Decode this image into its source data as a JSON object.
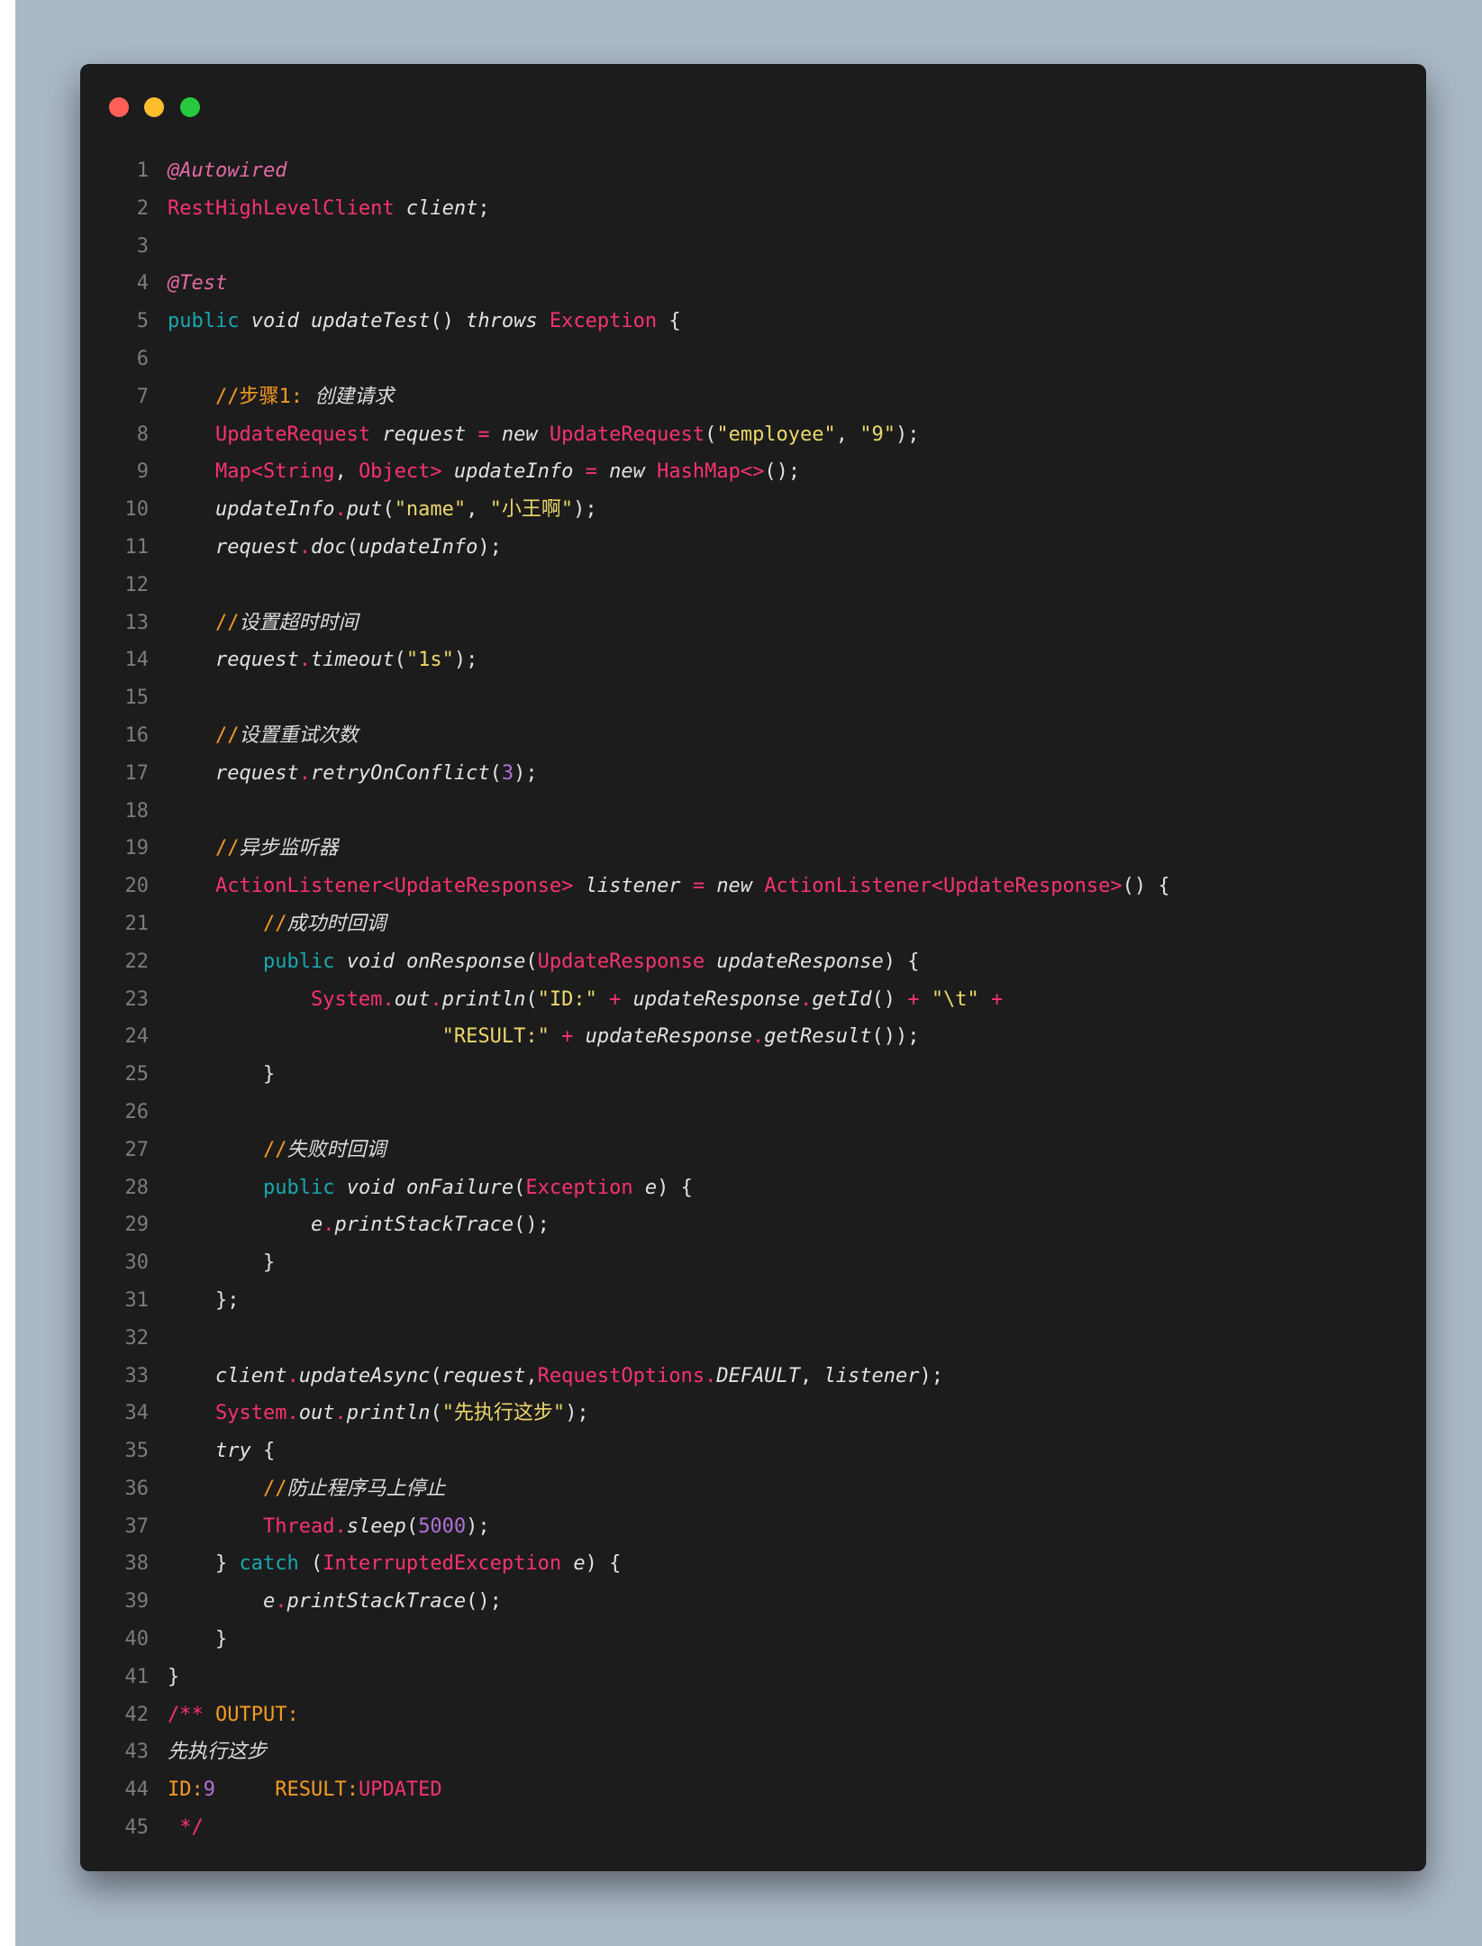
{
  "window": {
    "controls": [
      {
        "name": "close",
        "color": "#ff5f56"
      },
      {
        "name": "minimize",
        "color": "#ffbd2e"
      },
      {
        "name": "maximize",
        "color": "#27c93f"
      }
    ]
  },
  "lines": [
    [
      [
        "a",
        "@Autowired"
      ]
    ],
    [
      [
        "t",
        "RestHighLevelClient"
      ],
      [
        "p",
        " "
      ],
      [
        "i",
        "client"
      ],
      [
        "p",
        ";"
      ]
    ],
    [],
    [
      [
        "a",
        "@Test"
      ]
    ],
    [
      [
        "k",
        "public"
      ],
      [
        "p",
        " "
      ],
      [
        "i",
        "void"
      ],
      [
        "p",
        " "
      ],
      [
        "i",
        "updateTest"
      ],
      [
        "p",
        "() "
      ],
      [
        "i",
        "throws"
      ],
      [
        "p",
        " "
      ],
      [
        "t",
        "Exception"
      ],
      [
        "p",
        " {"
      ]
    ],
    [],
    [
      [
        "p",
        "    "
      ],
      [
        "c",
        "//步骤1: "
      ],
      [
        "ci",
        "创建请求"
      ]
    ],
    [
      [
        "p",
        "    "
      ],
      [
        "t",
        "UpdateRequest"
      ],
      [
        "p",
        " "
      ],
      [
        "i",
        "request"
      ],
      [
        "p",
        " "
      ],
      [
        "o",
        "="
      ],
      [
        "p",
        " "
      ],
      [
        "i",
        "new"
      ],
      [
        "p",
        " "
      ],
      [
        "t",
        "UpdateRequest"
      ],
      [
        "p",
        "("
      ],
      [
        "s",
        "\"employee\""
      ],
      [
        "p",
        ", "
      ],
      [
        "s",
        "\"9\""
      ],
      [
        "p",
        ");"
      ]
    ],
    [
      [
        "p",
        "    "
      ],
      [
        "t",
        "Map<String"
      ],
      [
        "p",
        ", "
      ],
      [
        "t",
        "Object>"
      ],
      [
        "p",
        " "
      ],
      [
        "i",
        "updateInfo"
      ],
      [
        "p",
        " "
      ],
      [
        "o",
        "="
      ],
      [
        "p",
        " "
      ],
      [
        "i",
        "new"
      ],
      [
        "p",
        " "
      ],
      [
        "t",
        "HashMap<>"
      ],
      [
        "p",
        "();"
      ]
    ],
    [
      [
        "p",
        "    "
      ],
      [
        "i",
        "updateInfo"
      ],
      [
        "o",
        "."
      ],
      [
        "i",
        "put"
      ],
      [
        "p",
        "("
      ],
      [
        "s",
        "\"name\""
      ],
      [
        "p",
        ", "
      ],
      [
        "s",
        "\"小王啊\""
      ],
      [
        "p",
        ");"
      ]
    ],
    [
      [
        "p",
        "    "
      ],
      [
        "i",
        "request"
      ],
      [
        "o",
        "."
      ],
      [
        "i",
        "doc"
      ],
      [
        "p",
        "("
      ],
      [
        "i",
        "updateInfo"
      ],
      [
        "p",
        ");"
      ]
    ],
    [],
    [
      [
        "p",
        "    "
      ],
      [
        "c",
        "//"
      ],
      [
        "ci",
        "设置超时时间"
      ]
    ],
    [
      [
        "p",
        "    "
      ],
      [
        "i",
        "request"
      ],
      [
        "o",
        "."
      ],
      [
        "i",
        "timeout"
      ],
      [
        "p",
        "("
      ],
      [
        "s",
        "\"1s\""
      ],
      [
        "p",
        ");"
      ]
    ],
    [],
    [
      [
        "p",
        "    "
      ],
      [
        "c",
        "//"
      ],
      [
        "ci",
        "设置重试次数"
      ]
    ],
    [
      [
        "p",
        "    "
      ],
      [
        "i",
        "request"
      ],
      [
        "o",
        "."
      ],
      [
        "i",
        "retryOnConflict"
      ],
      [
        "p",
        "("
      ],
      [
        "n",
        "3"
      ],
      [
        "p",
        ");"
      ]
    ],
    [],
    [
      [
        "p",
        "    "
      ],
      [
        "c",
        "//"
      ],
      [
        "ci",
        "异步监听器"
      ]
    ],
    [
      [
        "p",
        "    "
      ],
      [
        "t",
        "ActionListener<UpdateResponse>"
      ],
      [
        "p",
        " "
      ],
      [
        "i",
        "listener"
      ],
      [
        "p",
        " "
      ],
      [
        "o",
        "="
      ],
      [
        "p",
        " "
      ],
      [
        "i",
        "new"
      ],
      [
        "p",
        " "
      ],
      [
        "t",
        "ActionListener<UpdateResponse>"
      ],
      [
        "p",
        "() {"
      ]
    ],
    [
      [
        "p",
        "        "
      ],
      [
        "c",
        "//"
      ],
      [
        "ci",
        "成功时回调"
      ]
    ],
    [
      [
        "p",
        "        "
      ],
      [
        "k",
        "public"
      ],
      [
        "p",
        " "
      ],
      [
        "i",
        "void"
      ],
      [
        "p",
        " "
      ],
      [
        "i",
        "onResponse"
      ],
      [
        "p",
        "("
      ],
      [
        "t",
        "UpdateResponse"
      ],
      [
        "p",
        " "
      ],
      [
        "i",
        "updateResponse"
      ],
      [
        "p",
        ") {"
      ]
    ],
    [
      [
        "p",
        "            "
      ],
      [
        "t",
        "System"
      ],
      [
        "o",
        "."
      ],
      [
        "i",
        "out"
      ],
      [
        "o",
        "."
      ],
      [
        "i",
        "println"
      ],
      [
        "p",
        "("
      ],
      [
        "s",
        "\"ID:\""
      ],
      [
        "p",
        " "
      ],
      [
        "o",
        "+"
      ],
      [
        "p",
        " "
      ],
      [
        "i",
        "updateResponse"
      ],
      [
        "o",
        "."
      ],
      [
        "i",
        "getId"
      ],
      [
        "p",
        "() "
      ],
      [
        "o",
        "+"
      ],
      [
        "p",
        " "
      ],
      [
        "s",
        "\"\\t\""
      ],
      [
        "p",
        " "
      ],
      [
        "o",
        "+"
      ]
    ],
    [
      [
        "p",
        "                       "
      ],
      [
        "s",
        "\"RESULT:\""
      ],
      [
        "p",
        " "
      ],
      [
        "o",
        "+"
      ],
      [
        "p",
        " "
      ],
      [
        "i",
        "updateResponse"
      ],
      [
        "o",
        "."
      ],
      [
        "i",
        "getResult"
      ],
      [
        "p",
        "());"
      ]
    ],
    [
      [
        "p",
        "        }"
      ]
    ],
    [],
    [
      [
        "p",
        "        "
      ],
      [
        "c",
        "//"
      ],
      [
        "ci",
        "失败时回调"
      ]
    ],
    [
      [
        "p",
        "        "
      ],
      [
        "k",
        "public"
      ],
      [
        "p",
        " "
      ],
      [
        "i",
        "void"
      ],
      [
        "p",
        " "
      ],
      [
        "i",
        "onFailure"
      ],
      [
        "p",
        "("
      ],
      [
        "t",
        "Exception"
      ],
      [
        "p",
        " "
      ],
      [
        "i",
        "e"
      ],
      [
        "p",
        ") {"
      ]
    ],
    [
      [
        "p",
        "            "
      ],
      [
        "i",
        "e"
      ],
      [
        "o",
        "."
      ],
      [
        "i",
        "printStackTrace"
      ],
      [
        "p",
        "();"
      ]
    ],
    [
      [
        "p",
        "        }"
      ]
    ],
    [
      [
        "p",
        "    };"
      ]
    ],
    [],
    [
      [
        "p",
        "    "
      ],
      [
        "i",
        "client"
      ],
      [
        "o",
        "."
      ],
      [
        "i",
        "updateAsync"
      ],
      [
        "p",
        "("
      ],
      [
        "i",
        "request"
      ],
      [
        "p",
        ","
      ],
      [
        "t",
        "RequestOptions"
      ],
      [
        "o",
        "."
      ],
      [
        "i",
        "DEFAULT"
      ],
      [
        "p",
        ", "
      ],
      [
        "i",
        "listener"
      ],
      [
        "p",
        ");"
      ]
    ],
    [
      [
        "p",
        "    "
      ],
      [
        "t",
        "System"
      ],
      [
        "o",
        "."
      ],
      [
        "i",
        "out"
      ],
      [
        "o",
        "."
      ],
      [
        "i",
        "println"
      ],
      [
        "p",
        "("
      ],
      [
        "s",
        "\"先执行这步\""
      ],
      [
        "p",
        ");"
      ]
    ],
    [
      [
        "p",
        "    "
      ],
      [
        "i",
        "try"
      ],
      [
        "p",
        " {"
      ]
    ],
    [
      [
        "p",
        "        "
      ],
      [
        "c",
        "//"
      ],
      [
        "ci",
        "防止程序马上停止"
      ]
    ],
    [
      [
        "p",
        "        "
      ],
      [
        "t",
        "Thread"
      ],
      [
        "o",
        "."
      ],
      [
        "i",
        "sleep"
      ],
      [
        "p",
        "("
      ],
      [
        "n",
        "5000"
      ],
      [
        "p",
        ");"
      ]
    ],
    [
      [
        "p",
        "    } "
      ],
      [
        "k",
        "catch"
      ],
      [
        "p",
        " ("
      ],
      [
        "t",
        "InterruptedException"
      ],
      [
        "p",
        " "
      ],
      [
        "i",
        "e"
      ],
      [
        "p",
        ") {"
      ]
    ],
    [
      [
        "p",
        "        "
      ],
      [
        "i",
        "e"
      ],
      [
        "o",
        "."
      ],
      [
        "i",
        "printStackTrace"
      ],
      [
        "p",
        "();"
      ]
    ],
    [
      [
        "p",
        "    }"
      ]
    ],
    [
      [
        "p",
        "}"
      ]
    ],
    [
      [
        "o",
        "/**"
      ],
      [
        "r",
        " OUTPUT:"
      ]
    ],
    [
      [
        "ci",
        "先执行这步"
      ]
    ],
    [
      [
        "r",
        "ID:"
      ],
      [
        "n",
        "9"
      ],
      [
        "p",
        "     "
      ],
      [
        "r",
        "RESULT:"
      ],
      [
        "t",
        "UPDATED"
      ]
    ],
    [
      [
        "o",
        " */"
      ]
    ]
  ]
}
